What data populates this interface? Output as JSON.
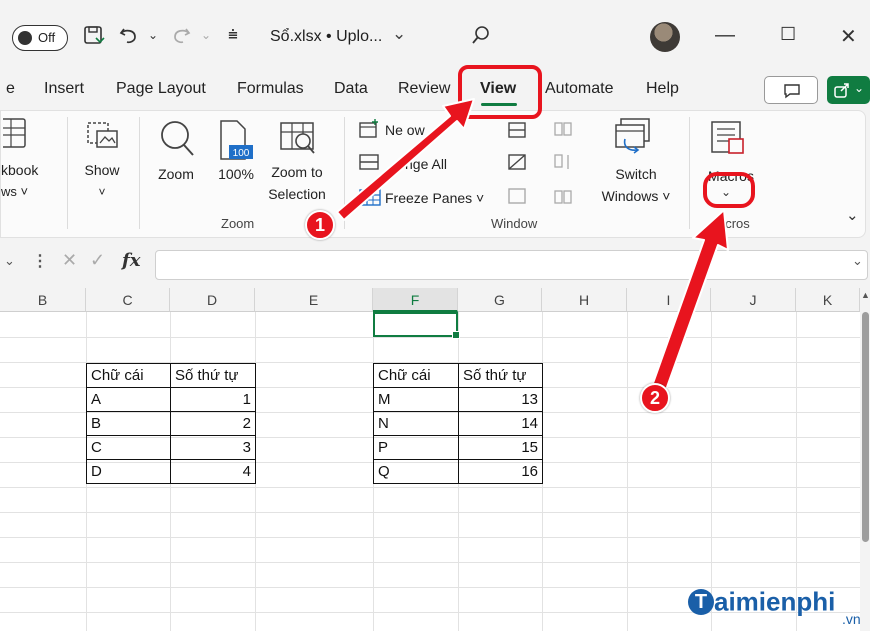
{
  "titlebar": {
    "autosave_label": "Off",
    "doc_title": "Sổ.xlsx • Uplo...",
    "icons": [
      "save-icon",
      "undo-icon",
      "redo-icon",
      "customize-qat-icon",
      "search-icon",
      "avatar",
      "minimize-icon",
      "maximize-icon",
      "close-icon"
    ]
  },
  "tabs": [
    "e",
    "Insert",
    "Page Layout",
    "Formulas",
    "Data",
    "Review",
    "View",
    "Automate",
    "Help"
  ],
  "active_tab": "View",
  "ribbon": {
    "workbook_views": [
      "kbook",
      "ws ˅"
    ],
    "show": [
      "Show",
      "˅"
    ],
    "zoom": "Zoom",
    "zoom100": "100%",
    "zoom100_icon_text": "100",
    "zoom_selection": [
      "Zoom to",
      "Selection"
    ],
    "new_window": "Ne    ow",
    "arrange_all": "nge All",
    "freeze_panes": "Freeze Panes ˅",
    "switch_windows": [
      "Switch",
      "Windows ˅"
    ],
    "macros": "Macros",
    "group_zoom": "Zoom",
    "group_window": "Window",
    "group_macros": "acros"
  },
  "formula_bar": {
    "fx": "fx",
    "value": ""
  },
  "columns": [
    "B",
    "C",
    "D",
    "E",
    "F",
    "G",
    "H",
    "I",
    "J",
    "K"
  ],
  "selected_column": "F",
  "table1": {
    "headers": [
      "Chữ cái",
      "Số thứ tự"
    ],
    "rows": [
      [
        "A",
        "1"
      ],
      [
        "B",
        "2"
      ],
      [
        "C",
        "3"
      ],
      [
        "D",
        "4"
      ]
    ]
  },
  "table2": {
    "headers": [
      "Chữ cái",
      "Số thứ tự"
    ],
    "rows": [
      [
        "M",
        "13"
      ],
      [
        "N",
        "14"
      ],
      [
        "P",
        "15"
      ],
      [
        "Q",
        "16"
      ]
    ]
  },
  "annotations": {
    "step1": "1",
    "step2": "2",
    "highlight_color": "#e8141e"
  },
  "watermark": {
    "main": "aimienphi",
    "sub": ".vn"
  },
  "colors": {
    "accent": "#107c41",
    "annotation": "#e8141e",
    "watermark": "#1a5fa8"
  }
}
